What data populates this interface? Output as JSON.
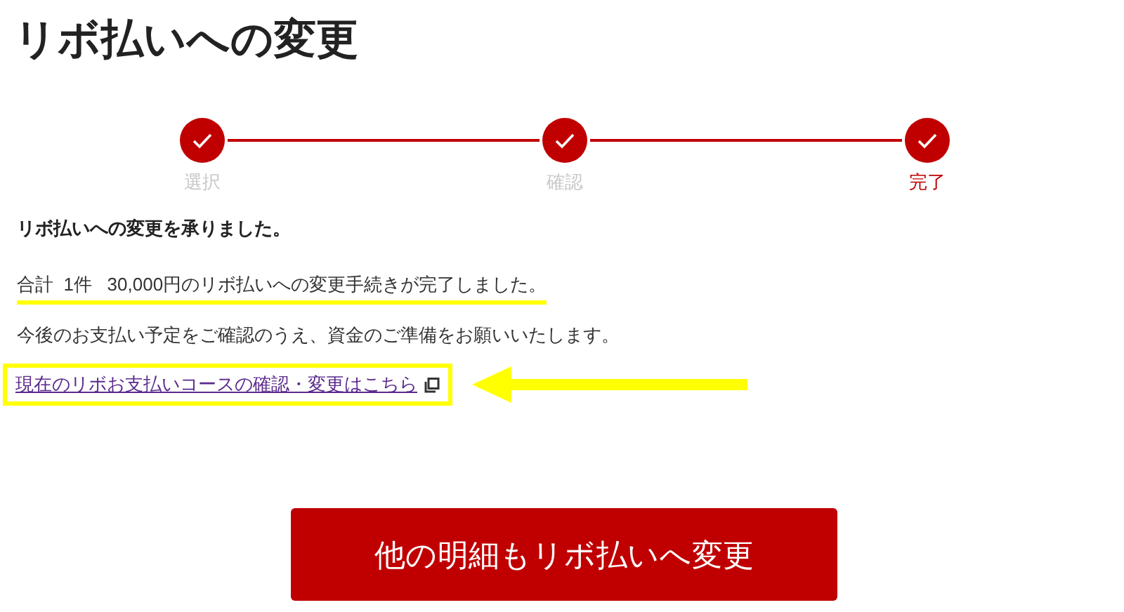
{
  "title": "リボ払いへの変更",
  "steps": [
    {
      "label": "選択",
      "selected": false
    },
    {
      "label": "確認",
      "selected": false
    },
    {
      "label": "完了",
      "selected": true
    }
  ],
  "heading": "リボ払いへの変更を承りました。",
  "summary": "合計  1件   30,000円のリボ払いへの変更手続きが完了しました。",
  "note": "今後のお支払い予定をご確認のうえ、資金のご準備をお願いいたします。",
  "link": "現在のリボお支払いコースの確認・変更はこちら",
  "button": "他の明細もリボ払いへ変更"
}
